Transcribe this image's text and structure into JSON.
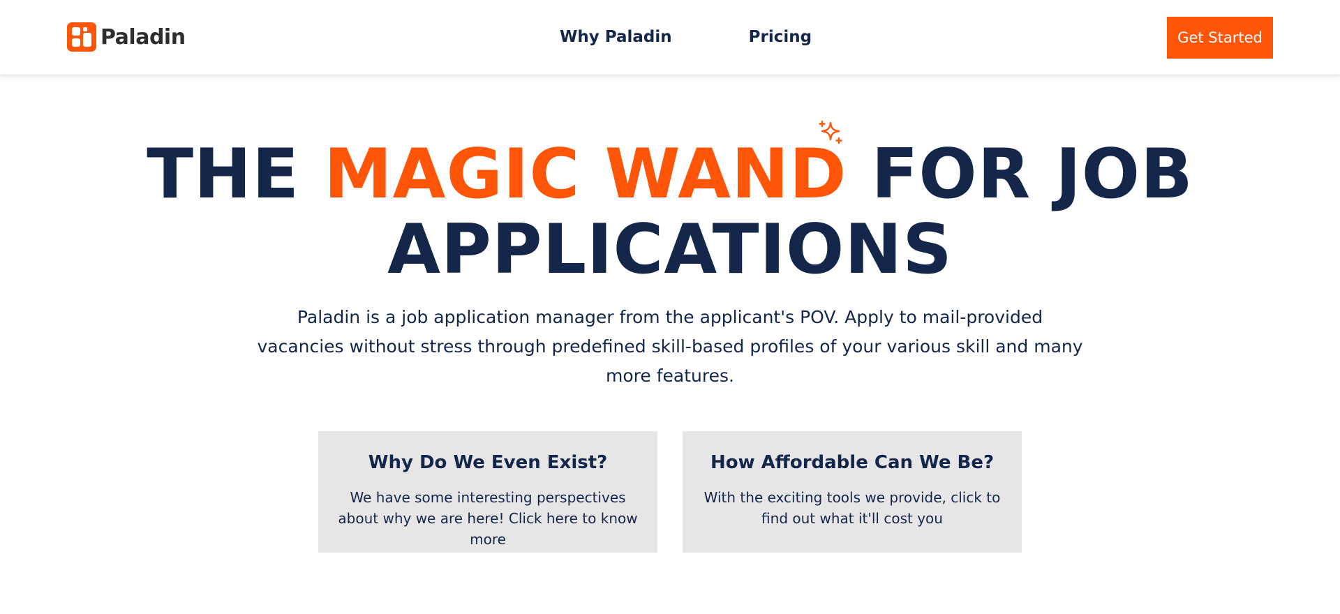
{
  "brand": {
    "name": "Paladin",
    "icon": "paladin-logo-icon",
    "accent_color": "#ff5508",
    "text_color": "#14264a"
  },
  "nav": {
    "links": [
      "Why Paladin",
      "Pricing"
    ],
    "cta_label": "Get Started"
  },
  "hero": {
    "title_prefix": "THE",
    "title_accent": "MAGIC WAND",
    "title_suffix": "FOR JOB APPLICATIONS",
    "sparkle_icon": "sparkle-icon",
    "description": "Paladin is a job application manager from the applicant's POV. Apply to mail-provided vacancies without stress through predefined skill-based profiles of your various skill and many more features."
  },
  "cards": [
    {
      "title": "Why Do We Even Exist?",
      "text": "We have some interesting perspectives about why we are here! Click here to know more"
    },
    {
      "title": "How Affordable Can We Be?",
      "text": "With the exciting tools we provide, click to find out what it'll cost you"
    }
  ]
}
